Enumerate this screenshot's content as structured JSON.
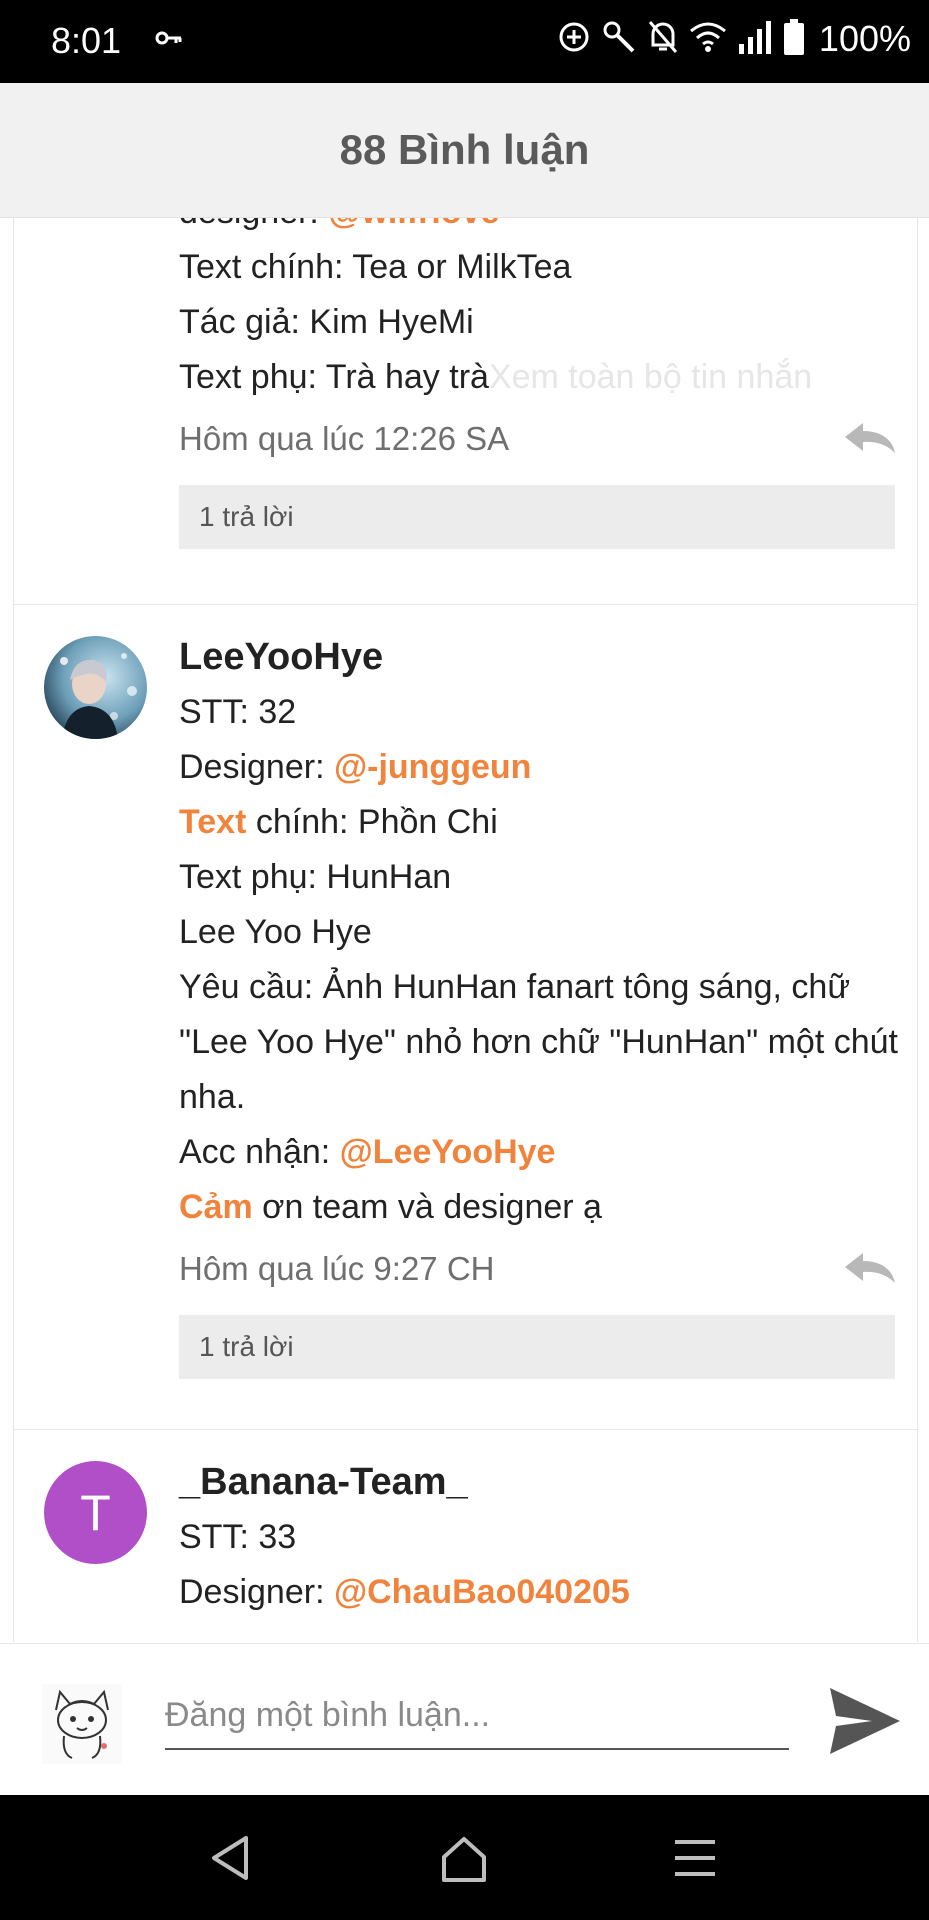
{
  "status_bar": {
    "time": "8:01",
    "battery": "100%",
    "icons": [
      "key-icon",
      "data-saver-icon",
      "wrench-icon",
      "notifications-off-icon",
      "wifi-icon",
      "signal-icon",
      "battery-icon"
    ]
  },
  "header": {
    "title": "88 Bình luận"
  },
  "comments": [
    {
      "lines": {
        "designer_label": "designer: ",
        "designer_handle": "@wilfrlove",
        "text_main": "Text chính: Tea or MilkTea",
        "author": "Tác giả: Kim HyeMi",
        "text_sub": "Text phụ: Trà hay trà",
        "see_all": "Xem toàn bộ tin nhắn"
      },
      "timestamp": "Hôm qua lúc 12:26 SA",
      "replies": "1 trả lời"
    },
    {
      "username": "LeeYooHye",
      "lines": {
        "stt": "STT: 32",
        "designer_label": "Designer: ",
        "designer_handle": "@-junggeun",
        "text_word": "Text",
        "text_main_rest": " chính: Phồn Chi",
        "text_sub": "Text phụ: HunHan",
        "name": "Lee Yoo Hye",
        "request": "Yêu cầu: Ảnh HunHan fanart tông sáng, chữ \"Lee Yoo Hye\" nhỏ hơn chữ \"HunHan\" một chút nha.",
        "acc_label": "Acc nhận: ",
        "acc_handle": "@LeeYooHye",
        "thanks_word": "Cảm",
        "thanks_rest": " ơn team và designer ạ"
      },
      "timestamp": "Hôm qua lúc 9:27 CH",
      "replies": "1 trả lời"
    },
    {
      "username": "_Banana-Team_",
      "avatar_letter": "T",
      "avatar_color": "#b04fc8",
      "lines": {
        "stt": "STT: 33",
        "designer_label": "Designer: ",
        "designer_handle": "@ChauBao040205"
      }
    }
  ],
  "composer": {
    "placeholder": "Đăng một bình luận..."
  },
  "colors": {
    "mention": "#f0843c",
    "header_bg": "#f1f1f1"
  }
}
